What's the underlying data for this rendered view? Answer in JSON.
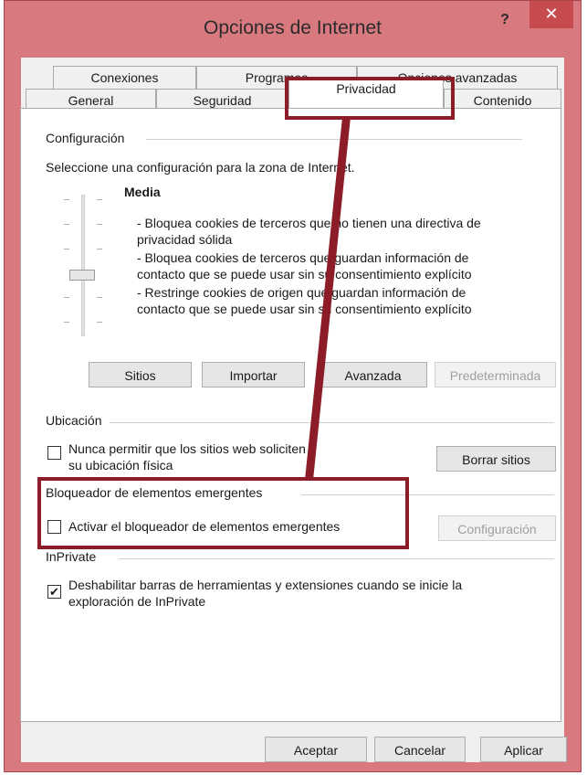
{
  "window": {
    "title": "Opciones de Internet",
    "help": "?",
    "close": "✕"
  },
  "tabs_back": [
    "Conexiones",
    "Programas",
    "Opciones avanzadas"
  ],
  "tabs_front": [
    "General",
    "Seguridad",
    "Privacidad",
    "Contenido"
  ],
  "config": {
    "label": "Configuración",
    "instructions": "Seleccione una configuración para la zona de Internet.",
    "level": "Media",
    "desc1": "- Bloquea cookies de terceros que no tienen una directiva de",
    "desc2": "privacidad sólida",
    "desc3": "- Bloquea cookies de terceros que guardan información de",
    "desc4": "contacto que se puede usar sin su consentimiento explícito",
    "desc5": "- Restringe cookies de origen que guardan información de",
    "desc6": "contacto que se puede usar sin su consentimiento explícito"
  },
  "buttons": {
    "sitios": "Sitios",
    "importar": "Importar",
    "avanzada": "Avanzada",
    "predeterminada": "Predeterminada"
  },
  "ubicacion": {
    "label": "Ubicación",
    "check1": "Nunca permitir que los sitios web soliciten",
    "check2": "su ubicación física",
    "borrar": "Borrar sitios"
  },
  "popup": {
    "label": "Bloqueador de elementos emergentes",
    "check": "Activar el bloqueador de elementos emergentes",
    "config": "Configuración"
  },
  "inprivate": {
    "label": "InPrivate",
    "check1": "Deshabilitar barras de herramientas y extensiones cuando se inicie la",
    "check2": "exploración de InPrivate",
    "checked_mark": "✔"
  },
  "footer": {
    "aceptar": "Aceptar",
    "cancelar": "Cancelar",
    "aplicar": "Aplicar"
  },
  "colors": {
    "frame": "#d8797f",
    "close": "#c74a4f",
    "highlight": "#8b1c28"
  }
}
